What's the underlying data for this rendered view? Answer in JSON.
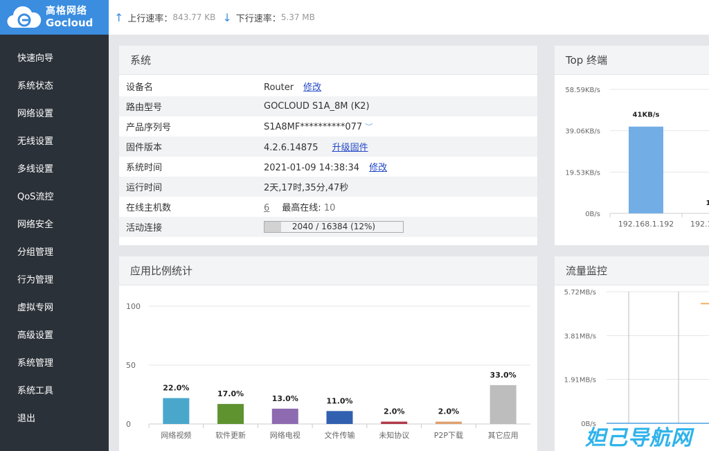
{
  "logo": {
    "cn": "高格网络",
    "en": "Gocloud"
  },
  "topbar": {
    "up_label": "上行速率：",
    "up_value": "843.77 KB",
    "down_label": "下行速率：",
    "down_value": "5.37 MB"
  },
  "sidebar": {
    "items": [
      {
        "label": "快速向导"
      },
      {
        "label": "系统状态"
      },
      {
        "label": "网络设置"
      },
      {
        "label": "无线设置"
      },
      {
        "label": "多线设置"
      },
      {
        "label": "QoS流控"
      },
      {
        "label": "网络安全"
      },
      {
        "label": "分组管理"
      },
      {
        "label": "行为管理"
      },
      {
        "label": "虚拟专网"
      },
      {
        "label": "高级设置"
      },
      {
        "label": "系统管理"
      },
      {
        "label": "系统工具"
      },
      {
        "label": "退出"
      }
    ]
  },
  "system": {
    "title": "系统",
    "device_name_label": "设备名",
    "device_name": "Router",
    "edit1": "修改",
    "model_label": "路由型号",
    "model": "GOCLOUD S1A_8M (K2)",
    "serial_label": "产品序列号",
    "serial": "S1A8MF**********077",
    "firmware_label": "固件版本",
    "firmware": "4.2.6.14875",
    "upgrade": "升级固件",
    "time_label": "系统时间",
    "time": "2021-01-09 14:38:34",
    "edit2": "修改",
    "uptime_label": "运行时间",
    "uptime": "2天,17时,35分,47秒",
    "hosts_label": "在线主机数",
    "hosts": "6",
    "max_label": "最高在线:",
    "max": "10",
    "conn_label": "活动连接",
    "conn_text": "2040 / 16384 (12%)",
    "conn_fraction": 0.12
  },
  "app_panel": {
    "title": "应用比例统计"
  },
  "top_panel": {
    "title": "Top 终端"
  },
  "flow_panel": {
    "title": "流量监控"
  },
  "chart_data": [
    {
      "type": "bar",
      "title": "",
      "ylim": [
        0,
        100
      ],
      "yticks": [
        "0",
        "50",
        "100"
      ],
      "categories": [
        "网络视频",
        "软件更新",
        "网络电视",
        "文件传输",
        "未知协议",
        "P2P下载",
        "其它应用"
      ],
      "values": [
        22,
        17,
        13,
        11,
        2,
        2,
        33
      ],
      "labels": [
        "22.0%",
        "17.0%",
        "13.0%",
        "11.0%",
        "2.0%",
        "2.0%",
        "33.0%"
      ],
      "colors": [
        "#4aa7cc",
        "#5f9330",
        "#8e6bb0",
        "#3260b0",
        "#b0394a",
        "#e0a070",
        "#bdbdbd"
      ]
    },
    {
      "type": "bar",
      "yticks": [
        "0B/s",
        "19.53KB/s",
        "39.06KB/s",
        "58.59KB/s"
      ],
      "ylim": [
        0,
        58.59
      ],
      "categories": [
        "192.168.1.192",
        "192.1"
      ],
      "values": [
        41
      ],
      "labels": [
        "41KB/s",
        "1"
      ],
      "color": "#73ade6"
    },
    {
      "type": "line",
      "yticks": [
        "0B/s",
        "1.91MB/s",
        "3.81MB/s",
        "5.72MB/s"
      ],
      "ylim": [
        0,
        5.72
      ],
      "series_colors": [
        "#f0b060",
        "#4a9fe0"
      ]
    }
  ],
  "watermark": "妲己导航网"
}
